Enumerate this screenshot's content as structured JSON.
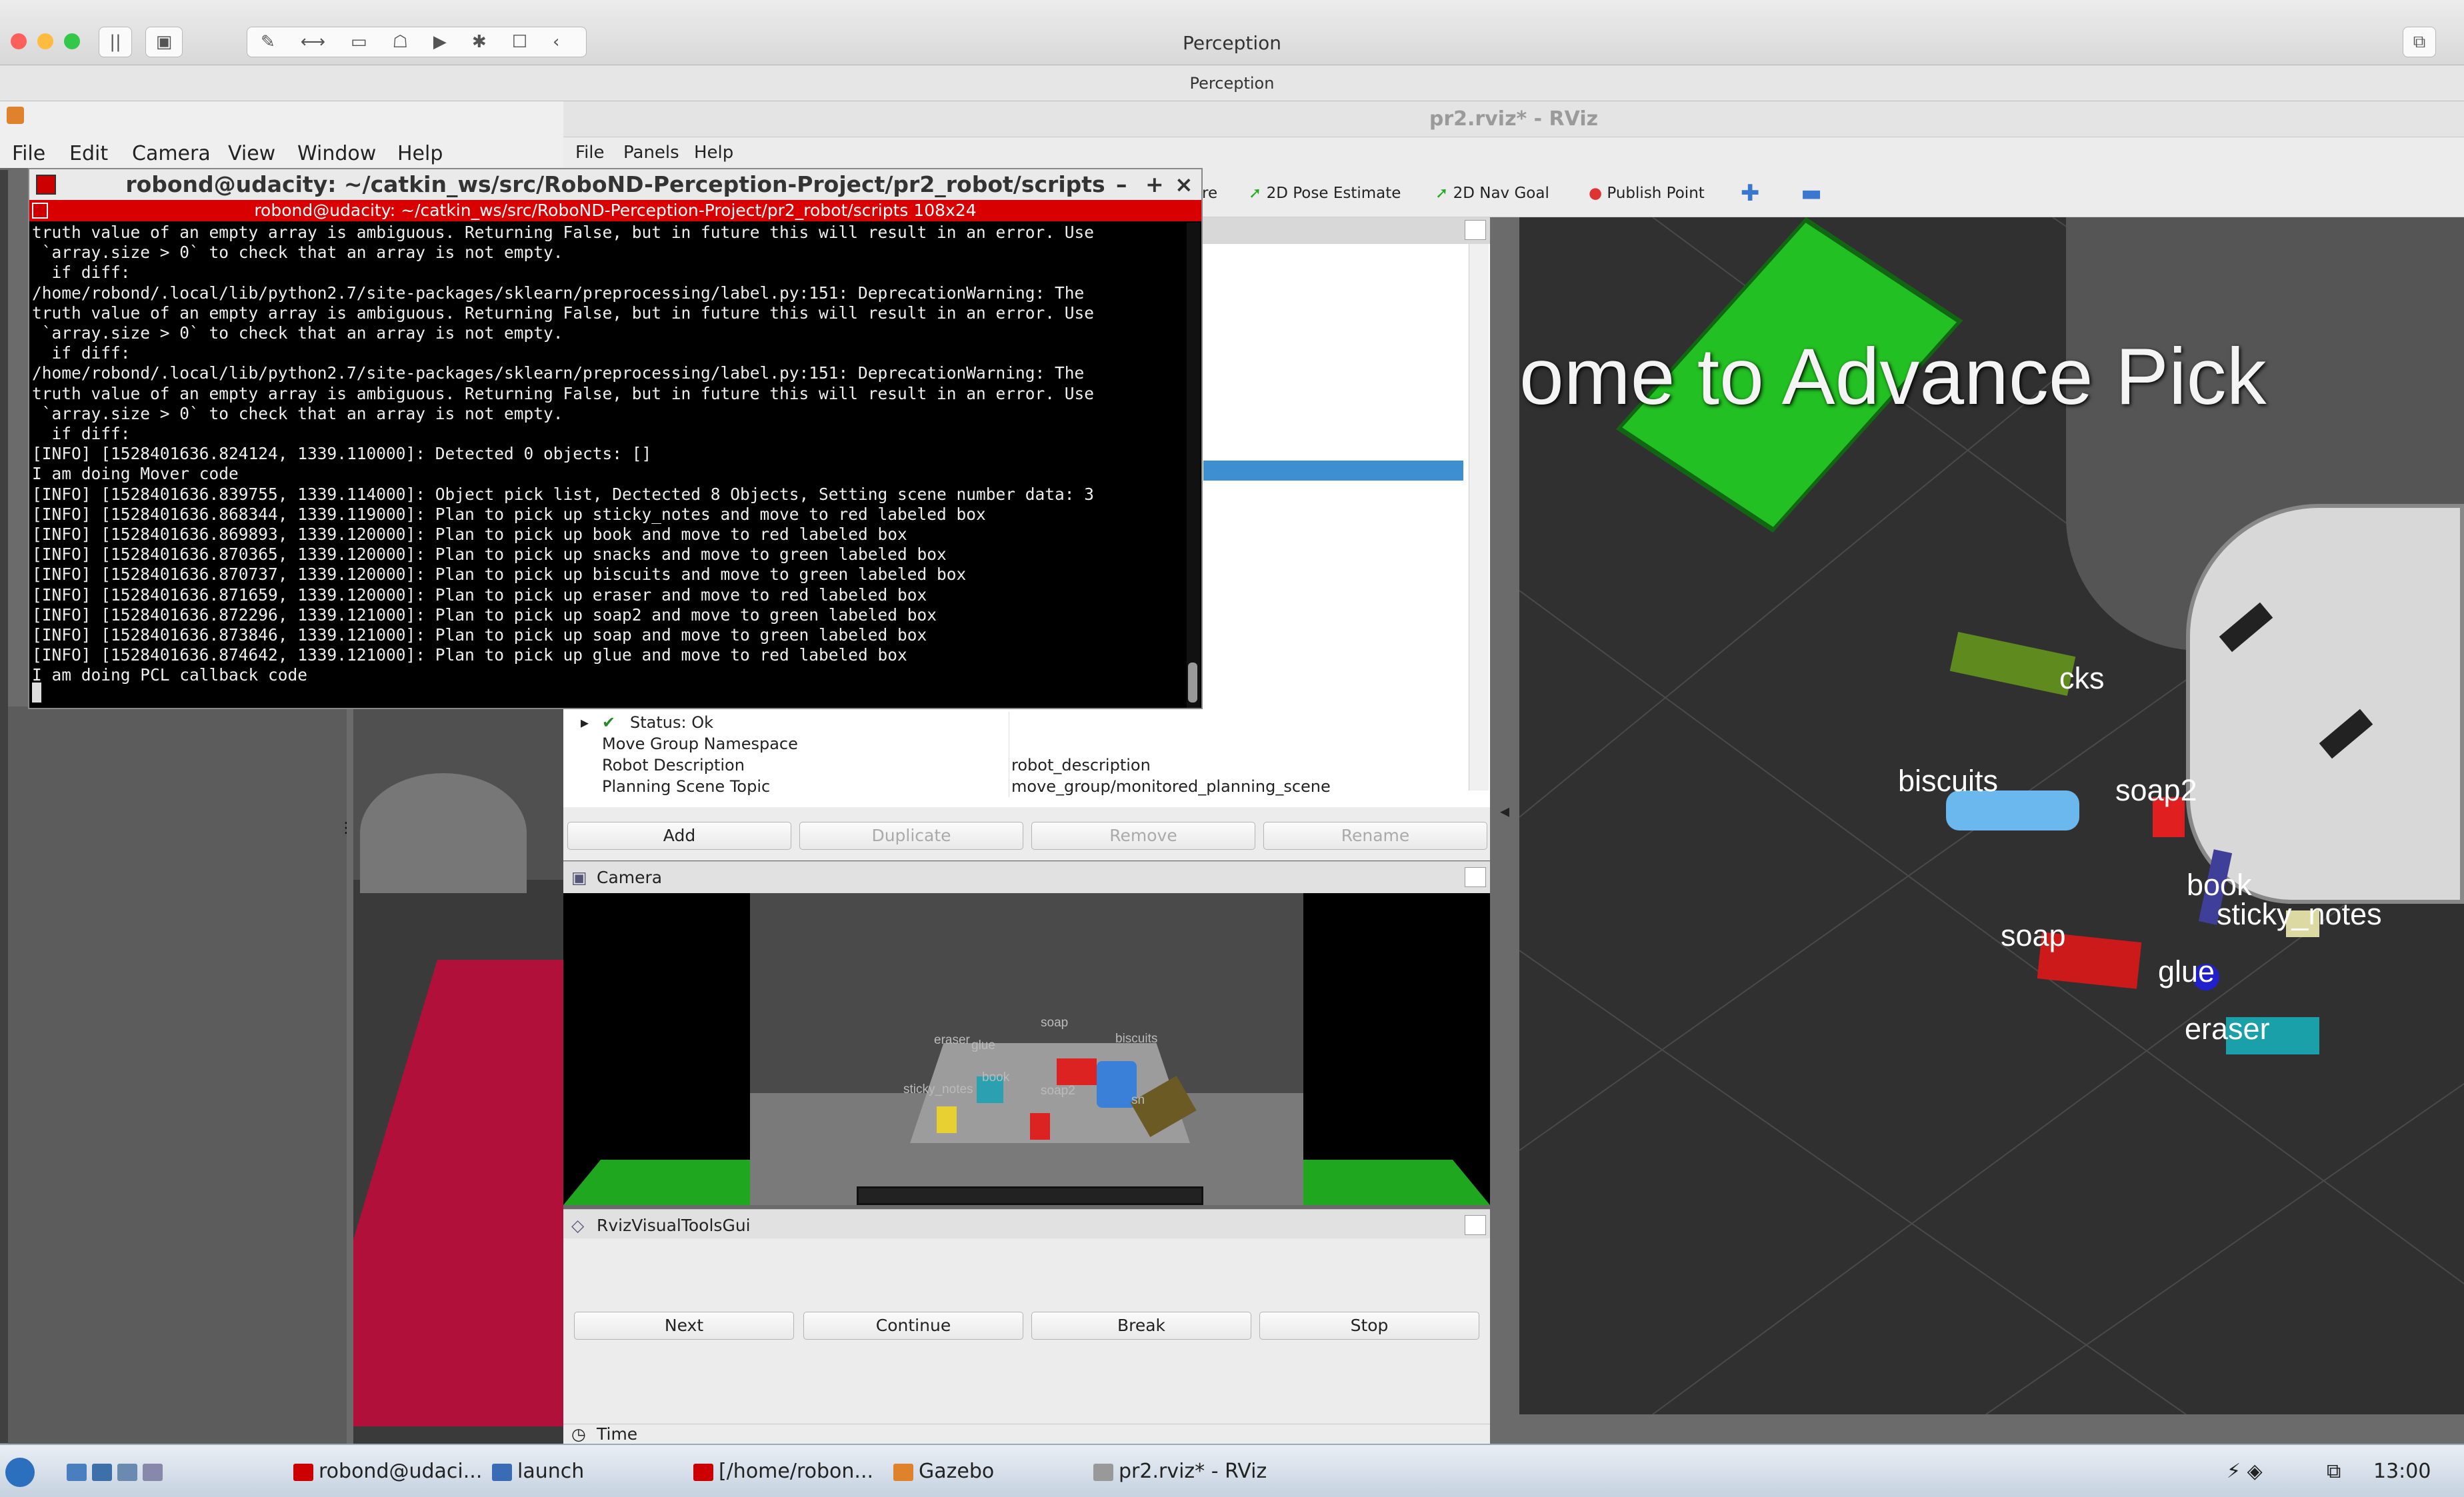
{
  "mac": {
    "title": "Perception",
    "subtitle": "Perception"
  },
  "gazebo": {
    "menu": [
      "File",
      "Edit",
      "Camera",
      "View",
      "Window",
      "Help"
    ]
  },
  "rviz": {
    "title": "pr2.rviz* - RViz",
    "menu": [
      "File",
      "Panels",
      "Help"
    ],
    "toolbar": {
      "tool_partial": "re",
      "pose": "2D Pose Estimate",
      "nav": "2D Nav Goal",
      "publish": "Publish Point"
    },
    "displays": {
      "status": "Status: Ok",
      "rows": [
        {
          "name": "Move Group Namespace",
          "value": ""
        },
        {
          "name": "Robot Description",
          "value": "robot_description"
        },
        {
          "name": "Planning Scene Topic",
          "value": "move_group/monitored_planning_scene"
        }
      ],
      "buttons": {
        "add": "Add",
        "duplicate": "Duplicate",
        "remove": "Remove",
        "rename": "Rename"
      }
    },
    "camera_panel": {
      "title": "Camera",
      "labels": [
        "eraser",
        "glue",
        "soap",
        "biscuits",
        "book",
        "sticky_notes",
        "soap2",
        "sn"
      ]
    },
    "visual_tools": {
      "title": "RvizVisualToolsGui",
      "next": "Next",
      "continue": "Continue",
      "break": "Break",
      "stop": "Stop"
    },
    "time_panel": {
      "title": "Time"
    },
    "scene": {
      "banner": "ome  to  Advance  Pick",
      "labels": {
        "snacks": "cks",
        "biscuits": "biscuits",
        "soap2": "soap2",
        "book": "book",
        "sticky": "sticky_notes",
        "soap": "soap",
        "glue": "glue",
        "eraser": "eraser"
      }
    }
  },
  "terminal": {
    "title": "robond@udacity: ~/catkin_ws/src/RoboND-Perception-Project/pr2_robot/scripts",
    "tab": "robond@udacity: ~/catkin_ws/src/RoboND-Perception-Project/pr2_robot/scripts 108x24",
    "lines": [
      "truth value of an empty array is ambiguous. Returning False, but in future this will result in an error. Use",
      " `array.size > 0` to check that an array is not empty.",
      "  if diff:",
      "/home/robond/.local/lib/python2.7/site-packages/sklearn/preprocessing/label.py:151: DeprecationWarning: The",
      "truth value of an empty array is ambiguous. Returning False, but in future this will result in an error. Use",
      " `array.size > 0` to check that an array is not empty.",
      "  if diff:",
      "/home/robond/.local/lib/python2.7/site-packages/sklearn/preprocessing/label.py:151: DeprecationWarning: The",
      "truth value of an empty array is ambiguous. Returning False, but in future this will result in an error. Use",
      " `array.size > 0` to check that an array is not empty.",
      "  if diff:",
      "[INFO] [1528401636.824124, 1339.110000]: Detected 0 objects: []",
      "I am doing Mover code",
      "[INFO] [1528401636.839755, 1339.114000]: Object pick list, Dectected 8 Objects, Setting scene number data: 3",
      "[INFO] [1528401636.868344, 1339.119000]: Plan to pick up sticky_notes and move to red labeled box",
      "[INFO] [1528401636.869893, 1339.120000]: Plan to pick up book and move to red labeled box",
      "[INFO] [1528401636.870365, 1339.120000]: Plan to pick up snacks and move to green labeled box",
      "[INFO] [1528401636.870737, 1339.120000]: Plan to pick up biscuits and move to green labeled box",
      "[INFO] [1528401636.871659, 1339.120000]: Plan to pick up eraser and move to red labeled box",
      "[INFO] [1528401636.872296, 1339.121000]: Plan to pick up soap2 and move to green labeled box",
      "[INFO] [1528401636.873846, 1339.121000]: Plan to pick up soap and move to green labeled box",
      "[INFO] [1528401636.874642, 1339.121000]: Plan to pick up glue and move to red labeled box",
      "I am doing PCL callback code"
    ]
  },
  "taskbar": {
    "items": [
      "robond@udaci...",
      "launch",
      "[/home/robon...",
      "Gazebo",
      "pr2.rviz* - RViz"
    ],
    "clock": "13:00"
  }
}
